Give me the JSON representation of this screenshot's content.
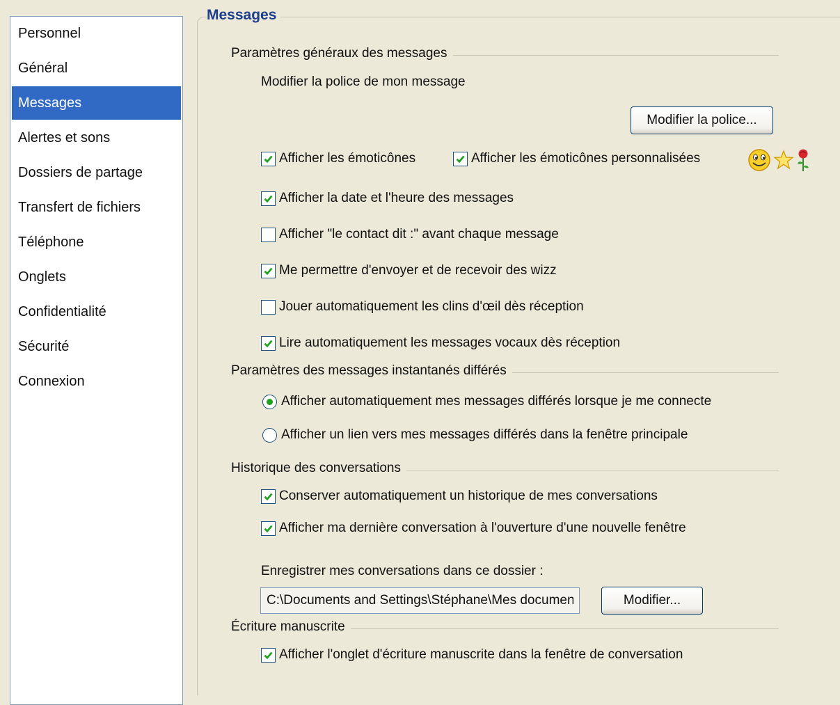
{
  "sidebar": {
    "items": [
      {
        "label": "Personnel"
      },
      {
        "label": "Général"
      },
      {
        "label": "Messages"
      },
      {
        "label": "Alertes et sons"
      },
      {
        "label": "Dossiers de partage"
      },
      {
        "label": "Transfert de fichiers"
      },
      {
        "label": "Téléphone"
      },
      {
        "label": "Onglets"
      },
      {
        "label": "Confidentialité"
      },
      {
        "label": "Sécurité"
      },
      {
        "label": "Connexion"
      }
    ],
    "selected": "Messages"
  },
  "page": {
    "title": "Messages"
  },
  "general": {
    "header": "Paramètres généraux des messages",
    "font_label": "Modifier la police de mon message",
    "font_button": "Modifier la police...",
    "show_emoticons": "Afficher les émoticônes",
    "show_custom_emoticons": "Afficher les émoticônes personnalisées",
    "emoticon_icons": [
      "smiley-icon",
      "star-icon",
      "rose-icon"
    ],
    "show_date_time": "Afficher la date et l'heure des messages",
    "show_contact_says": "Afficher \"le contact dit :\" avant chaque message",
    "allow_wizz": "Me permettre d'envoyer et de recevoir des wizz",
    "autoplay_winks": "Jouer automatiquement les clins d'œil dès réception",
    "autoplay_voice": "Lire automatiquement les messages vocaux dès réception"
  },
  "offline": {
    "header": "Paramètres des messages instantanés différés",
    "auto_show": "Afficher automatiquement mes messages différés lorsque je me connecte",
    "show_link": "Afficher un lien vers mes messages différés dans la fenêtre principale"
  },
  "history": {
    "header": "Historique des conversations",
    "keep_history": "Conserver automatiquement un historique de mes conversations",
    "show_last": "Afficher ma dernière conversation à l'ouverture d'une nouvelle fenêtre",
    "folder_label": "Enregistrer mes conversations dans ce dossier :",
    "folder_path": "C:\\Documents and Settings\\Stéphane\\Mes documents\\Mes fichiers reçus",
    "modify_button": "Modifier..."
  },
  "handwriting": {
    "header": "Écriture manuscrite",
    "show_tab": "Afficher l'onglet d'écriture manuscrite dans la fenêtre de conversation"
  },
  "colors": {
    "window_bg": "#ECE9D8",
    "selection": "#316AC5",
    "title": "#1C3E8C",
    "checkmark": "#21A121",
    "control_border": "#1C5180"
  }
}
